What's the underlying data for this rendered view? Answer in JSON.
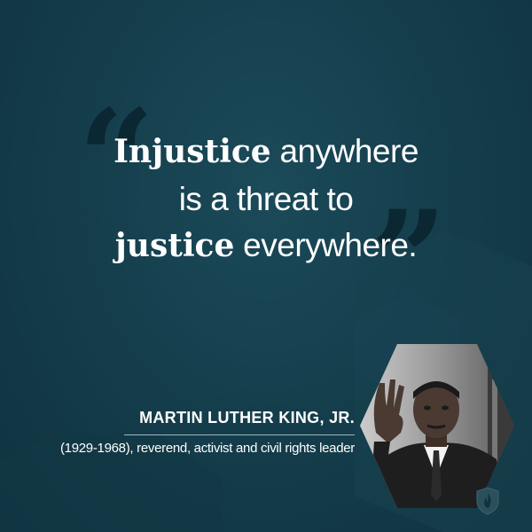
{
  "quote": {
    "line1_bold": "Injustice",
    "line1_rest": " anywhere",
    "line2": "is a threat to",
    "line3_bold": "justice",
    "line3_rest": " everywhere."
  },
  "quote_marks": {
    "open": "“",
    "close": "”"
  },
  "author": {
    "name": "MARTIN LUTHER KING, JR.",
    "description": "(1929-1968), reverend, activist and civil rights leader"
  },
  "icons": {
    "portrait": "hexagon-portrait-photo",
    "logo": "shield-flame-icon"
  },
  "colors": {
    "background": "#143c4a",
    "text": "#ffffff",
    "quote_mark": "#0b2732",
    "rule": "#9fb7c0"
  }
}
